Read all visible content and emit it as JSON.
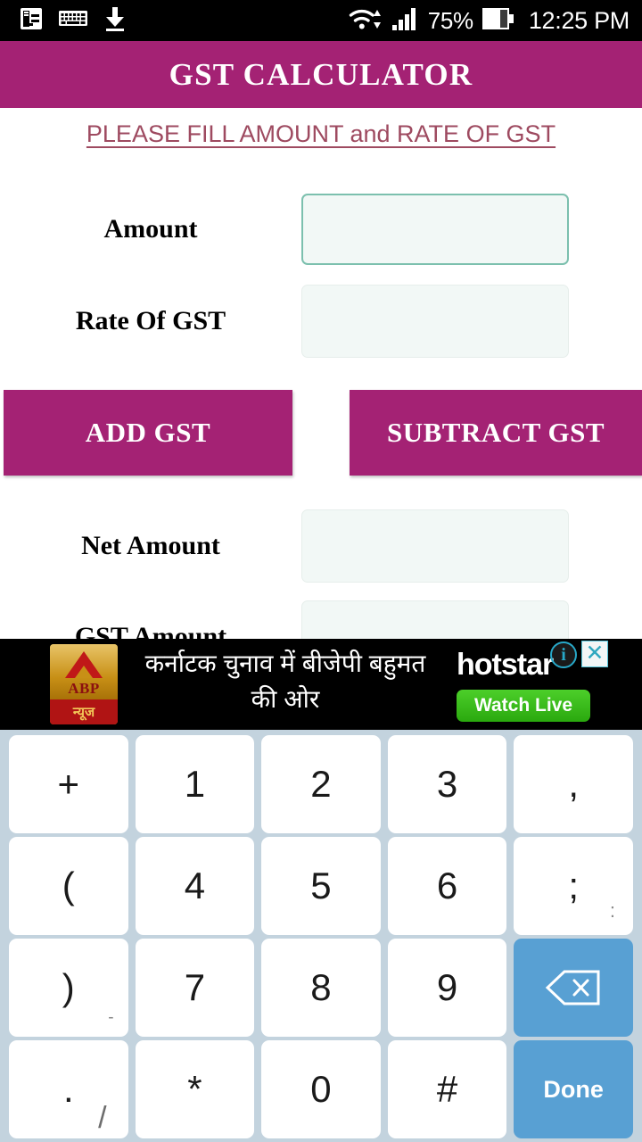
{
  "statusbar": {
    "icons": [
      "notes-icon",
      "keyboard-icon",
      "download-icon",
      "wifi-icon",
      "signal-icon"
    ],
    "battery_percent": "75%",
    "time": "12:25 PM"
  },
  "app": {
    "title": "GST CALCULATOR",
    "accent_color": "#a42274",
    "subtitle": "PLEASE FILL AMOUNT and RATE OF GST",
    "subtitle_color": "#9e4a60"
  },
  "form": {
    "fields": [
      {
        "label": "Amount",
        "value": "",
        "focused": true
      },
      {
        "label": "Rate Of GST",
        "value": "",
        "focused": false
      },
      {
        "label": "Net Amount",
        "value": "",
        "focused": false
      },
      {
        "label": "GST Amount",
        "value": "",
        "focused": false
      }
    ]
  },
  "buttons": {
    "add": "ADD GST",
    "subtract": "SUBTRACT GST"
  },
  "ad": {
    "advertiser": "ABP",
    "advertiser_sub": "न्यूज",
    "headline_line1": "कर्नाटक चुनाव में बीजेपी बहुमत",
    "headline_line2": "की ओर",
    "brand": "hotstar",
    "cta": "Watch Live",
    "info_icon": "info-icon",
    "close_icon": "close-icon",
    "close_glyph": "✕",
    "info_glyph": "i"
  },
  "keyboard": {
    "accent_color": "#58a0d3",
    "background_color": "#c3d3de",
    "rows": [
      [
        {
          "main": "+",
          "sub": "",
          "type": "char"
        },
        {
          "main": "1",
          "sub": "",
          "type": "char"
        },
        {
          "main": "2",
          "sub": "",
          "type": "char"
        },
        {
          "main": "3",
          "sub": "",
          "type": "char"
        },
        {
          "main": ",",
          "sub": "",
          "type": "char"
        }
      ],
      [
        {
          "main": "(",
          "sub": "",
          "type": "char"
        },
        {
          "main": "4",
          "sub": "",
          "type": "char"
        },
        {
          "main": "5",
          "sub": "",
          "type": "char"
        },
        {
          "main": "6",
          "sub": "",
          "type": "char"
        },
        {
          "main": ";",
          "sub": ":",
          "type": "char"
        }
      ],
      [
        {
          "main": ")",
          "sub": "-",
          "type": "char"
        },
        {
          "main": "7",
          "sub": "",
          "type": "char"
        },
        {
          "main": "8",
          "sub": "",
          "type": "char"
        },
        {
          "main": "9",
          "sub": "",
          "type": "char"
        },
        {
          "main": "",
          "sub": "",
          "type": "backspace"
        }
      ],
      [
        {
          "main": ".",
          "sub": "/",
          "type": "char"
        },
        {
          "main": "*",
          "sub": "",
          "type": "char"
        },
        {
          "main": "0",
          "sub": "",
          "type": "char"
        },
        {
          "main": "#",
          "sub": "",
          "type": "char"
        },
        {
          "main": "Done",
          "sub": "",
          "type": "done"
        }
      ]
    ]
  }
}
